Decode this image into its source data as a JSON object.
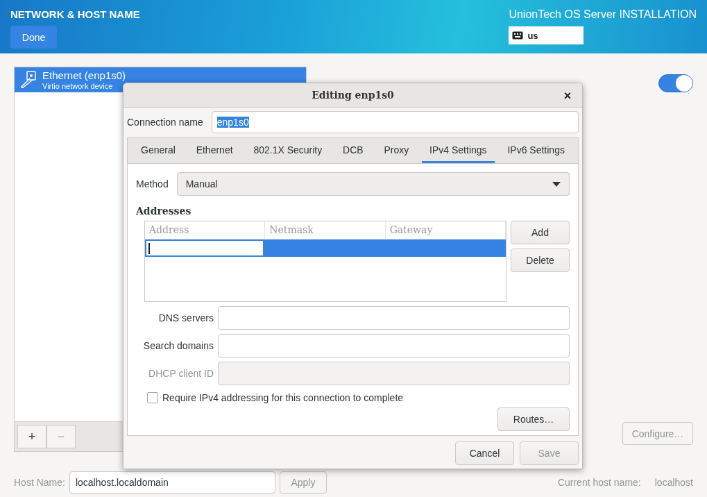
{
  "header": {
    "title": "NETWORK & HOST NAME",
    "done_button": "Done",
    "product": "UnionTech OS Server INSTALLATION",
    "keyboard_layout": "us"
  },
  "device_list": {
    "items": [
      {
        "name": "Ethernet (enp1s0)",
        "description": "Virtio network device",
        "selected": true
      }
    ],
    "add_button": "+",
    "remove_button": "−",
    "remove_disabled": true
  },
  "device_switch": {
    "on": true
  },
  "configure_button": {
    "label": "Configure…",
    "disabled": true
  },
  "host_name": {
    "label": "Host Name:",
    "value": "localhost.localdomain",
    "apply_button": "Apply"
  },
  "current_host": {
    "label": "Current host name:",
    "value": "localhost"
  },
  "dialog": {
    "title": "Editing enp1s0",
    "close": "×",
    "connection_name": {
      "label": "Connection name",
      "value": "enp1s0",
      "text_selected": true
    },
    "tabs": [
      {
        "label": "General",
        "selected": false
      },
      {
        "label": "Ethernet",
        "selected": false
      },
      {
        "label": "802.1X Security",
        "selected": false
      },
      {
        "label": "DCB",
        "selected": false
      },
      {
        "label": "Proxy",
        "selected": false
      },
      {
        "label": "IPv4 Settings",
        "selected": true
      },
      {
        "label": "IPv6 Settings",
        "selected": false
      }
    ],
    "method": {
      "label": "Method",
      "value": "Manual"
    },
    "addresses": {
      "heading": "Addresses",
      "columns": [
        "Address",
        "Netmask",
        "Gateway"
      ],
      "rows": [
        {
          "selected": true,
          "editing": true
        }
      ],
      "add_button": "Add",
      "delete_button": "Delete"
    },
    "fields": [
      {
        "label": "DNS servers",
        "disabled": false
      },
      {
        "label": "Search domains",
        "disabled": false
      },
      {
        "label": "DHCP client ID",
        "disabled": true
      }
    ],
    "require_checkbox": {
      "label": "Require IPv4 addressing for this connection to complete",
      "checked": false
    },
    "routes_button": "Routes…",
    "cancel_button": {
      "label": "Cancel",
      "disabled": false
    },
    "save_button": {
      "label": "Save",
      "disabled": true
    }
  }
}
